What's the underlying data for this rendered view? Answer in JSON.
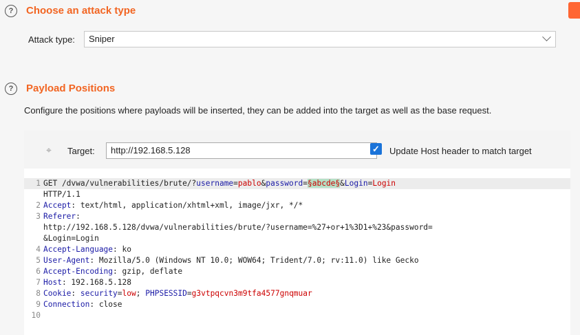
{
  "attack_section": {
    "help_icon": "?",
    "title": "Choose an attack type",
    "attack_type_label": "Attack type:",
    "attack_type_value": "Sniper"
  },
  "payload_section": {
    "help_icon": "?",
    "title": "Payload Positions",
    "description": "Configure the positions where payloads will be inserted, they can be added into the target as well as the base request.",
    "target_label": "Target:",
    "target_value": "http://192.168.5.128",
    "update_host_checked": true,
    "update_host_label": "Update Host header to match target"
  },
  "request": {
    "line1": {
      "num": "1",
      "method_path": "GET /dvwa/vulnerabilities/brute/?",
      "p1k": "username",
      "eq1": "=",
      "p1v": "pablo",
      "amp1": "&",
      "p2k": "password",
      "eq2": "=",
      "p2v": "§abcde§",
      "amp2": "&",
      "p3k": "Login",
      "eq3": "=",
      "p3v": "Login",
      "cont": "HTTP/1.1"
    },
    "line2": {
      "num": "2",
      "k": "Accept",
      "v": ": text/html, application/xhtml+xml, image/jxr, */*"
    },
    "line3": {
      "num": "3",
      "k": "Referer",
      "v": ":",
      "cont1": "http://192.168.5.128/dvwa/vulnerabilities/brute/?username=%27+or+1%3D1+%23&password=",
      "cont2": "&Login=Login"
    },
    "line4": {
      "num": "4",
      "k": "Accept-Language",
      "v": ": ko"
    },
    "line5": {
      "num": "5",
      "k": "User-Agent",
      "v": ": Mozilla/5.0 (Windows NT 10.0; WOW64; Trident/7.0; rv:11.0) like Gecko"
    },
    "line6": {
      "num": "6",
      "k": "Accept-Encoding",
      "v": ": gzip, deflate"
    },
    "line7": {
      "num": "7",
      "k": "Host",
      "v": ": 192.168.5.128"
    },
    "line8": {
      "num": "8",
      "k": "Cookie",
      "sep": ": ",
      "c1k": "security",
      "c1eq": "=",
      "c1v": "low",
      "c1sep": "; ",
      "c2k": "PHPSESSID",
      "c2eq": "=",
      "c2v": "g3vtpqcvn3m9tfa4577gnqmuar"
    },
    "line9": {
      "num": "9",
      "k": "Connection",
      "v": ": close"
    },
    "line10": {
      "num": "10"
    }
  },
  "colors": {
    "accent": "#f26522",
    "checkbox": "#1a73d9",
    "param_key": "#1a1aa6",
    "param_value": "#cc0000",
    "payload_marker_bg": "#b5e0c6"
  },
  "icons": {
    "help": "question-circle-icon",
    "target": "crosshair-icon",
    "dropdown": "chevron-down-icon"
  }
}
